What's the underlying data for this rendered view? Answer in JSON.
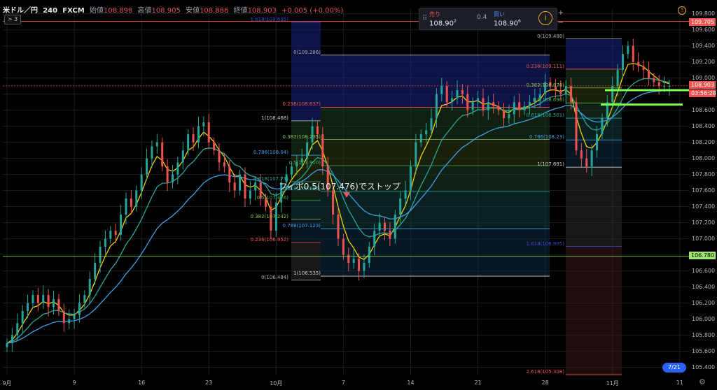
{
  "header": {
    "symbol": "米ドル／円",
    "timeframe": "240",
    "broker": "FXCM",
    "open_label": "始値",
    "open": "108.898",
    "high_label": "高値",
    "high": "108.905",
    "low_label": "安値",
    "low": "108.886",
    "close_label": "終値",
    "close": "108.903",
    "change": "+0.005 (+0.00%)"
  },
  "collapse_label": "> 3",
  "trade_panel": {
    "sell_label": "売り",
    "sell_price": "108.90",
    "sell_sup": "2",
    "spread": "0.4",
    "buy_label": "買い",
    "buy_price": "108.90",
    "buy_sup": "6",
    "info_icon": "i"
  },
  "zoom": {
    "plus": "+",
    "minus": "−"
  },
  "price_tags": {
    "high_line": "109.705",
    "current": "108.903",
    "countdown": "03:56:28",
    "level": "106.780"
  },
  "annotation": "フィボ0.5(107.476)でストップ",
  "logo": "7/21",
  "colors": {
    "bg": "#000000",
    "grid": "#1b1d22",
    "up": "#26a69a",
    "down": "#ef5350",
    "ma_fast": "#f5d000",
    "ma_mid": "#26a69a",
    "ma_slow": "#3aa0e8",
    "accent": "#2962ff"
  },
  "chart_data": {
    "type": "line",
    "title": "米ドル／円 240 FXCM",
    "ylim": [
      105.3,
      109.85
    ],
    "ylabel": "",
    "xlabel": "",
    "y_ticks": [
      109.8,
      109.6,
      109.4,
      109.2,
      109.0,
      108.8,
      108.6,
      108.4,
      108.2,
      108.0,
      107.8,
      107.6,
      107.4,
      107.2,
      107.0,
      106.8,
      106.6,
      106.4,
      106.2,
      106.0,
      105.8,
      105.6,
      105.4
    ],
    "x_ticks": [
      "9月",
      "9",
      "16",
      "23",
      "10月",
      "7",
      "14",
      "21",
      "28",
      "11月",
      "11"
    ],
    "x_tick_index": [
      0,
      13,
      26,
      39,
      52,
      65,
      78,
      91,
      104,
      117,
      130
    ],
    "series": [
      {
        "name": "close",
        "values": [
          105.7,
          105.8,
          105.95,
          106.1,
          106.2,
          106.3,
          106.2,
          106.3,
          106.15,
          106.25,
          106.1,
          105.95,
          106.0,
          106.05,
          106.2,
          106.3,
          106.5,
          106.7,
          106.9,
          107.0,
          107.1,
          107.05,
          107.3,
          107.5,
          107.4,
          107.6,
          107.8,
          108.0,
          108.15,
          108.2,
          107.9,
          107.7,
          107.8,
          107.95,
          108.1,
          108.3,
          108.2,
          108.4,
          108.45,
          108.2,
          108.1,
          107.95,
          107.9,
          107.7,
          107.6,
          107.8,
          107.5,
          107.6,
          107.7,
          107.5,
          107.4,
          107.1,
          107.45,
          107.7,
          107.8,
          107.9,
          107.95,
          108.0,
          108.2,
          108.4,
          108.3,
          107.9,
          107.6,
          107.3,
          107.0,
          106.8,
          106.7,
          106.75,
          106.6,
          106.7,
          106.9,
          107.1,
          107.2,
          107.1,
          107.0,
          107.3,
          107.5,
          107.6,
          107.9,
          108.2,
          108.3,
          108.35,
          108.5,
          108.8,
          108.9,
          108.7,
          108.75,
          108.85,
          108.8,
          108.6,
          108.7,
          108.75,
          108.6,
          108.7,
          108.65,
          108.6,
          108.5,
          108.55,
          108.7,
          108.6,
          108.65,
          108.7,
          108.75,
          108.8,
          108.95,
          108.9,
          108.85,
          108.8,
          108.9,
          108.7,
          108.1,
          108.0,
          107.9,
          108.1,
          108.3,
          108.5,
          108.7,
          108.9,
          109.1,
          109.3,
          109.4,
          109.2,
          109.15,
          109.1,
          109.0,
          108.95,
          108.9,
          108.9,
          108.903
        ]
      },
      {
        "name": "ma_fast",
        "values": []
      },
      {
        "name": "ma_mid",
        "values": []
      },
      {
        "name": "ma_slow",
        "values": []
      }
    ],
    "fib_sets": [
      {
        "name": "fib-left",
        "levels": [
          {
            "label": "1.618(109.695)",
            "value": 109.695,
            "color": "#3848d8"
          },
          {
            "label": "1(108.468)",
            "value": 108.468,
            "color": "#cccccc"
          },
          {
            "label": "0.786(108.04)",
            "value": 108.04,
            "color": "#3aa0e8"
          },
          {
            "label": "0.618(107.71)",
            "value": 107.71,
            "color": "#26a69a"
          },
          {
            "label": "0.5(107.476)",
            "value": 107.476,
            "color": "#4caf50"
          },
          {
            "label": "0.382(107.242)",
            "value": 107.242,
            "color": "#8bc34a"
          },
          {
            "label": "0.236(106.952)",
            "value": 106.952,
            "color": "#ef5350"
          },
          {
            "label": "0(106.484)",
            "value": 106.484,
            "color": "#aaaaaa"
          }
        ]
      },
      {
        "name": "fib-mid",
        "levels": [
          {
            "label": "0(109.286)",
            "value": 109.286,
            "color": "#aaaaaa"
          },
          {
            "label": "0.236(108.637)",
            "value": 108.637,
            "color": "#ef5350"
          },
          {
            "label": "0.382(108.235)",
            "value": 108.235,
            "color": "#8bc34a"
          },
          {
            "label": "0.5(107.910)",
            "value": 107.91,
            "color": "#4caf50"
          },
          {
            "label": "0.618(107.586)",
            "value": 107.586,
            "color": "#26a69a"
          },
          {
            "label": "0.786(107.123)",
            "value": 107.123,
            "color": "#3aa0e8"
          },
          {
            "label": "1(106.535)",
            "value": 106.535,
            "color": "#cccccc"
          }
        ]
      },
      {
        "name": "fib-right",
        "levels": [
          {
            "label": "0(109.488)",
            "value": 109.488,
            "color": "#aaaaaa"
          },
          {
            "label": "0.236(109.111)",
            "value": 109.111,
            "color": "#ef5350"
          },
          {
            "label": "0.382(108.878)",
            "value": 108.878,
            "color": "#8bc34a"
          },
          {
            "label": "0.5(108.690)",
            "value": 108.69,
            "color": "#4caf50"
          },
          {
            "label": "0.618(108.501)",
            "value": 108.501,
            "color": "#26a69a"
          },
          {
            "label": "0.786(108.23)",
            "value": 108.23,
            "color": "#3aa0e8"
          },
          {
            "label": "1(107.891)",
            "value": 107.891,
            "color": "#cccccc"
          },
          {
            "label": "1.618(106.905)",
            "value": 106.905,
            "color": "#3848d8"
          },
          {
            "label": "2.618(105.308)",
            "value": 105.308,
            "color": "#ef5350"
          }
        ]
      }
    ]
  }
}
